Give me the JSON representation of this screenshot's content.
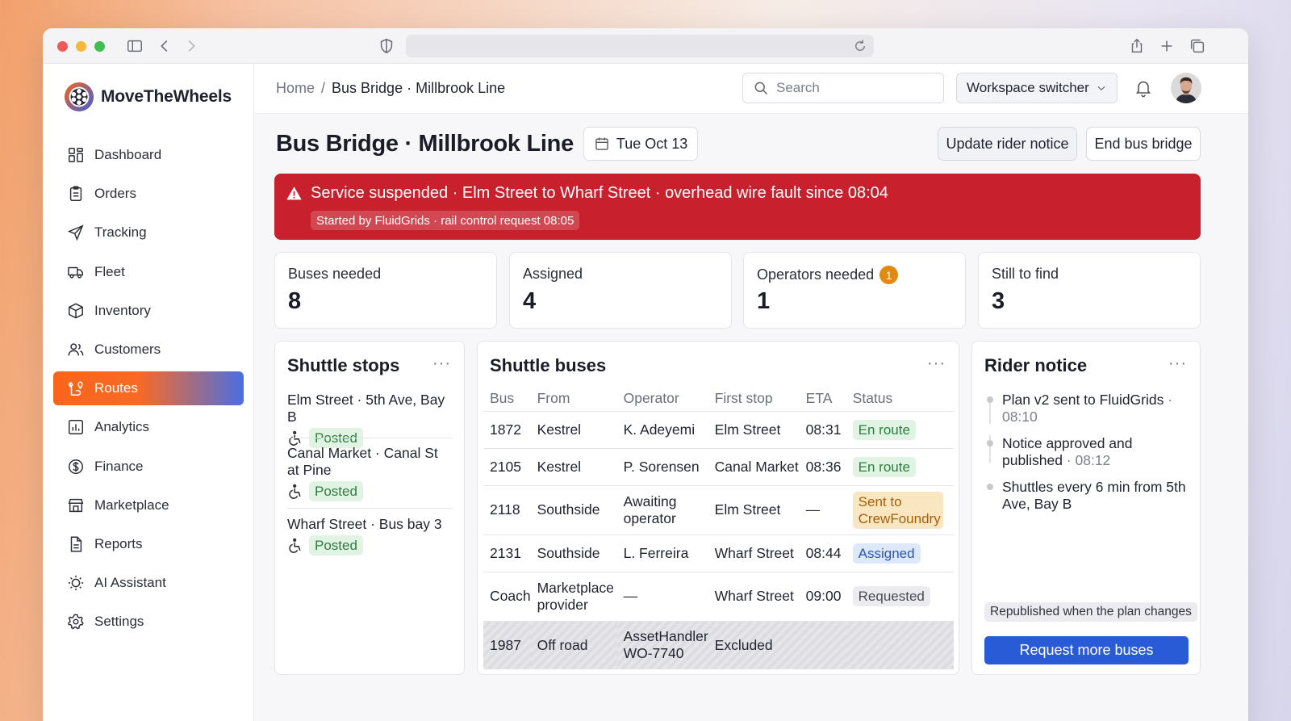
{
  "app": {
    "name": "MoveTheWheels"
  },
  "sidebar": {
    "items": [
      {
        "label": "Dashboard",
        "icon": "dashboard-icon"
      },
      {
        "label": "Orders",
        "icon": "clipboard-icon"
      },
      {
        "label": "Tracking",
        "icon": "send-icon"
      },
      {
        "label": "Fleet",
        "icon": "truck-icon"
      },
      {
        "label": "Inventory",
        "icon": "box-icon"
      },
      {
        "label": "Customers",
        "icon": "users-icon"
      },
      {
        "label": "Routes",
        "icon": "route-icon",
        "active": true
      },
      {
        "label": "Analytics",
        "icon": "chart-icon"
      },
      {
        "label": "Finance",
        "icon": "dollar-icon"
      },
      {
        "label": "Marketplace",
        "icon": "store-icon"
      },
      {
        "label": "Reports",
        "icon": "file-icon"
      },
      {
        "label": "AI Assistant",
        "icon": "sparkle-icon"
      },
      {
        "label": "Settings",
        "icon": "gear-icon"
      }
    ]
  },
  "topbar": {
    "breadcrumb_home": "Home",
    "breadcrumb_sep": "/",
    "breadcrumb_current": "Bus Bridge · Millbrook Line",
    "search_placeholder": "Search",
    "workspace_switcher": "Workspace switcher"
  },
  "page": {
    "title": "Bus Bridge · Millbrook Line",
    "date": "Tue Oct 13",
    "update_button": "Update rider notice",
    "end_button": "End bus bridge"
  },
  "alert": {
    "message": "Service suspended · Elm Street to Wharf Street · overhead wire fault since 08:04",
    "sub": "Started by FluidGrids · rail control request 08:05"
  },
  "stats": [
    {
      "label": "Buses needed",
      "value": "8"
    },
    {
      "label": "Assigned",
      "value": "4"
    },
    {
      "label": "Operators needed",
      "value": "1",
      "badge": "1"
    },
    {
      "label": "Still to find",
      "value": "3"
    }
  ],
  "shuttle_stops": {
    "title": "Shuttle stops",
    "more": "···",
    "stops": [
      {
        "name": "Elm Street · 5th Ave, Bay B",
        "status": "Posted"
      },
      {
        "name": "Canal Market · Canal St at Pine",
        "status": "Posted"
      },
      {
        "name": "Wharf Street · Bus bay 3",
        "status": "Posted"
      }
    ]
  },
  "shuttle_buses": {
    "title": "Shuttle buses",
    "more": "···",
    "columns": [
      "Bus",
      "From",
      "Operator",
      "First stop",
      "ETA",
      "Status"
    ],
    "rows": [
      {
        "bus": "1872",
        "from": "Kestrel",
        "operator": "K. Adeyemi",
        "first_stop": "Elm Street",
        "eta": "08:31",
        "status": "En route",
        "tone": "green"
      },
      {
        "bus": "2105",
        "from": "Kestrel",
        "operator": "P. Sorensen",
        "first_stop": "Canal Market",
        "eta": "08:36",
        "status": "En route",
        "tone": "green"
      },
      {
        "bus": "2118",
        "from": "Southside",
        "operator": "Awaiting operator",
        "first_stop": "Elm Street",
        "eta": "—",
        "status": "Sent to CrewFoundry",
        "tone": "amber"
      },
      {
        "bus": "2131",
        "from": "Southside",
        "operator": "L. Ferreira",
        "first_stop": "Wharf Street",
        "eta": "08:44",
        "status": "Assigned",
        "tone": "blue"
      },
      {
        "bus": "Coach",
        "from": "Marketplace provider",
        "operator": "—",
        "first_stop": "Wharf Street",
        "eta": "09:00",
        "status": "Requested",
        "tone": "grey"
      },
      {
        "bus": "1987",
        "from": "Off road",
        "operator": "AssetHandler WO-7740",
        "first_stop": "Excluded",
        "eta": "",
        "status": "",
        "tone": "excluded"
      }
    ]
  },
  "rider_notice": {
    "title": "Rider notice",
    "more": "···",
    "timeline": [
      {
        "text": "Plan v2 sent to FluidGrids",
        "time": "08:10"
      },
      {
        "text": "Notice approved and published",
        "time": "08:12"
      },
      {
        "text": "Shuttles every 6 min from 5th Ave, Bay B",
        "time": ""
      }
    ],
    "republish": "Republished when the plan changes",
    "request_button": "Request more buses"
  },
  "colors": {
    "accent": "#f9651b",
    "alert": "#c8202c",
    "primary_button": "#2a5bd7",
    "badge": "#e08a12"
  }
}
